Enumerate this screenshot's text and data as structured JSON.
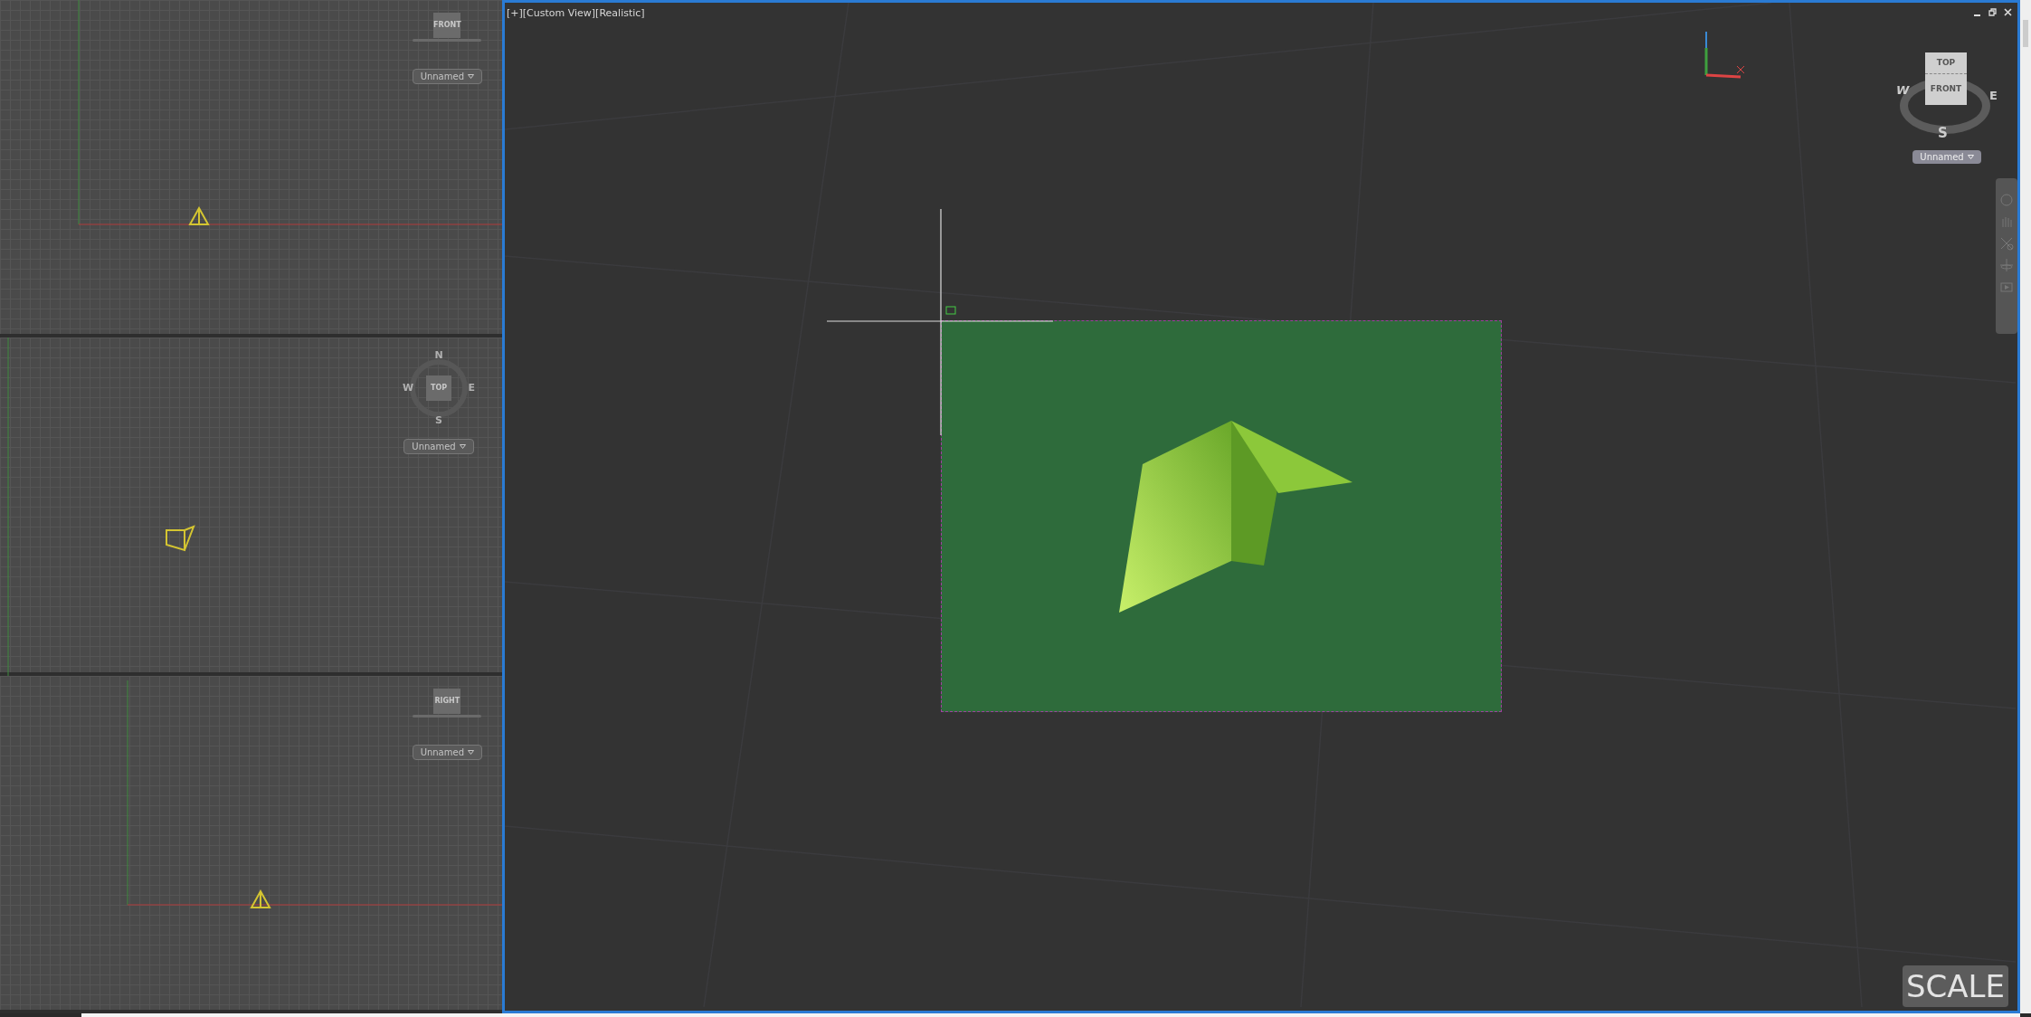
{
  "side_viewports": [
    {
      "kind": "cube",
      "cube_label": "FRONT",
      "view_menu": "Unnamed"
    },
    {
      "kind": "compass",
      "cube_label": "TOP",
      "compass": {
        "n": "N",
        "w": "W",
        "e": "E",
        "s": "S"
      },
      "view_menu": "Unnamed"
    },
    {
      "kind": "cube",
      "cube_label": "RIGHT",
      "view_menu": "Unnamed"
    }
  ],
  "main_viewport": {
    "label": "[+][Custom View][Realistic]",
    "viewcube": {
      "top": "TOP",
      "front": "FRONT",
      "w": "W",
      "e": "E",
      "s": "S",
      "view_menu": "Unnamed"
    },
    "command_overlay": "SCALE"
  }
}
